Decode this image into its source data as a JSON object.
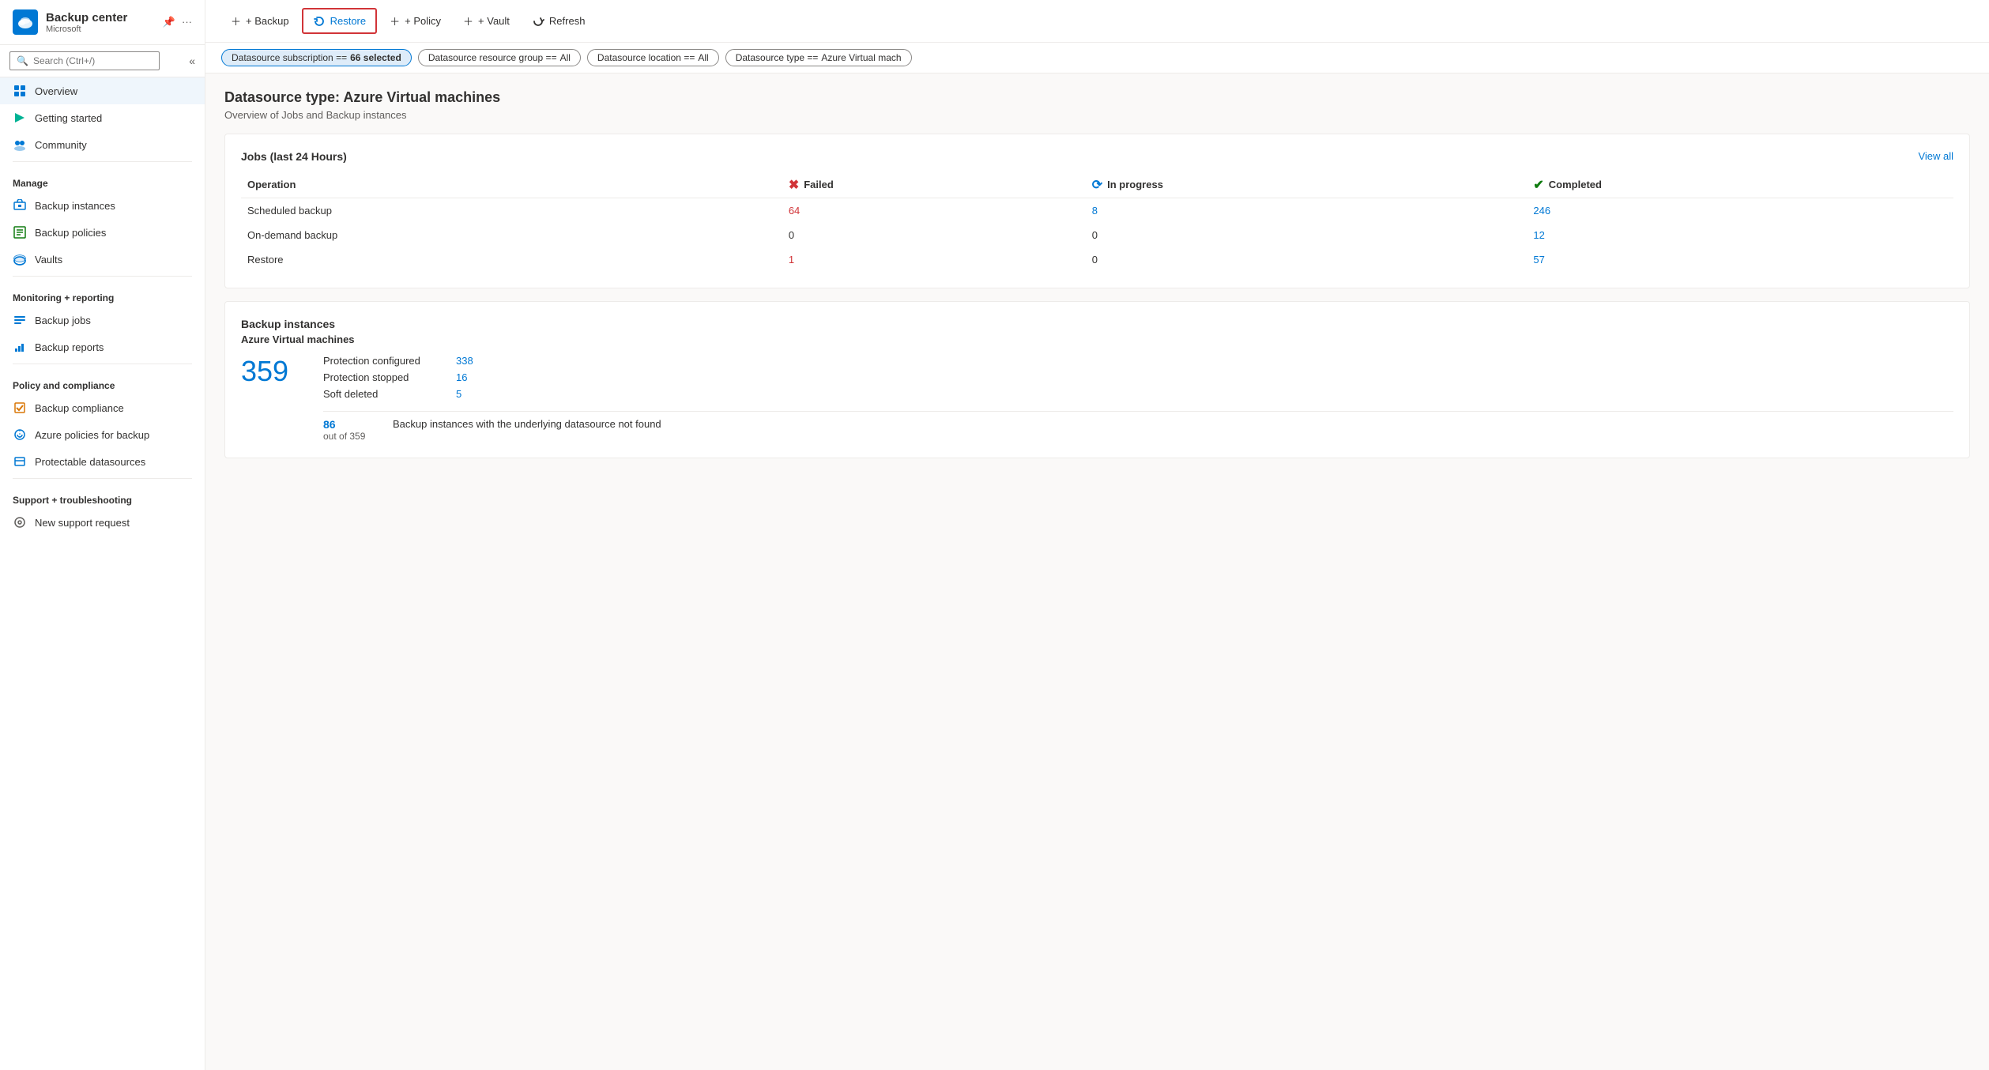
{
  "app": {
    "title": "Backup center",
    "subtitle": "Microsoft",
    "logo_char": "☁"
  },
  "search": {
    "placeholder": "Search (Ctrl+/)"
  },
  "nav": {
    "top_items": [
      {
        "id": "overview",
        "label": "Overview",
        "active": true
      },
      {
        "id": "getting-started",
        "label": "Getting started",
        "active": false
      },
      {
        "id": "community",
        "label": "Community",
        "active": false
      }
    ],
    "sections": [
      {
        "label": "Manage",
        "items": [
          {
            "id": "backup-instances",
            "label": "Backup instances"
          },
          {
            "id": "backup-policies",
            "label": "Backup policies"
          },
          {
            "id": "vaults",
            "label": "Vaults"
          }
        ]
      },
      {
        "label": "Monitoring + reporting",
        "items": [
          {
            "id": "backup-jobs",
            "label": "Backup jobs"
          },
          {
            "id": "backup-reports",
            "label": "Backup reports"
          }
        ]
      },
      {
        "label": "Policy and compliance",
        "items": [
          {
            "id": "backup-compliance",
            "label": "Backup compliance"
          },
          {
            "id": "azure-policies",
            "label": "Azure policies for backup"
          },
          {
            "id": "protectable-datasources",
            "label": "Protectable datasources"
          }
        ]
      },
      {
        "label": "Support + troubleshooting",
        "items": [
          {
            "id": "new-support",
            "label": "New support request"
          }
        ]
      }
    ]
  },
  "toolbar": {
    "backup_label": "+ Backup",
    "restore_label": "Restore",
    "policy_label": "+ Policy",
    "vault_label": "+ Vault",
    "refresh_label": "Refresh"
  },
  "filters": [
    {
      "id": "subscription",
      "prefix": "Datasource subscription == ",
      "value": "66 selected",
      "active": true
    },
    {
      "id": "resource-group",
      "prefix": "Datasource resource group == ",
      "value": "All",
      "active": false
    },
    {
      "id": "location",
      "prefix": "Datasource location == ",
      "value": "All",
      "active": false
    },
    {
      "id": "type",
      "prefix": "Datasource type == ",
      "value": "Azure Virtual mach",
      "active": false
    }
  ],
  "content": {
    "title": "Datasource type: Azure Virtual machines",
    "subtitle": "Overview of Jobs and Backup instances",
    "jobs_card": {
      "title": "Jobs (last 24 Hours)",
      "view_all": "View all",
      "columns": {
        "operation": "Operation",
        "failed": "Failed",
        "in_progress": "In progress",
        "completed": "Completed"
      },
      "rows": [
        {
          "operation": "Scheduled backup",
          "failed": "64",
          "in_progress": "8",
          "completed": "246"
        },
        {
          "operation": "On-demand backup",
          "failed": "0",
          "in_progress": "0",
          "completed": "12"
        },
        {
          "operation": "Restore",
          "failed": "1",
          "in_progress": "0",
          "completed": "57"
        }
      ]
    },
    "backup_instances_card": {
      "title": "Backup instances",
      "subtitle": "Azure Virtual machines",
      "total": "359",
      "details": [
        {
          "label": "Protection configured",
          "value": "338"
        },
        {
          "label": "Protection stopped",
          "value": "16"
        },
        {
          "label": "Soft deleted",
          "value": "5"
        }
      ],
      "sub_number": "86",
      "sub_out_of": "out of 359",
      "sub_label": "Backup instances with the underlying datasource not found"
    }
  }
}
